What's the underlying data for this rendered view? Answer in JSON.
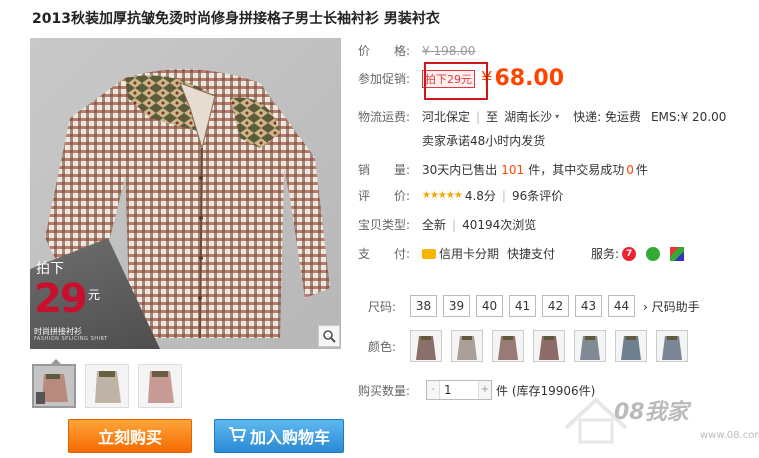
{
  "title": "2013秋装加厚抗皱免烫时尚修身拼接格子男士长袖衬衫 男装衬衣",
  "image_promo": {
    "pai": "拍下",
    "num": "29",
    "yuan": "元",
    "sub": "时尚拼接衬衫",
    "sub_en": "FASHION SPLICING SHIRT"
  },
  "price": {
    "label": "价　　格:",
    "original": "¥ 198.00"
  },
  "promotion": {
    "label": "参加促销:",
    "tag": "拍下29元",
    "currency": "¥",
    "value": "68.00"
  },
  "shipping": {
    "label": "物流运费:",
    "from": "河北保定",
    "to_word": "至",
    "to": "湖南长沙",
    "express": "快递: 免运费",
    "ems": "EMS:¥ 20.00",
    "promise": "卖家承诺48小时内发货"
  },
  "sales": {
    "label": "销　　量:",
    "prefix": "30天内已售出",
    "count": "101",
    "mid": "件，其中交易成功",
    "success": "0",
    "suffix": "件"
  },
  "rating": {
    "label": "评　　价:",
    "stars": "★★★★★",
    "score": "4.8分",
    "reviews": "96条评价"
  },
  "item_type": {
    "label": "宝贝类型:",
    "value": "全新",
    "views": "40194次浏览"
  },
  "payment": {
    "label": "支　　付:",
    "credit": "信用卡分期",
    "quick": "快捷支付",
    "service_label": "服务:"
  },
  "sizes": {
    "label": "尺码:",
    "options": [
      "38",
      "39",
      "40",
      "41",
      "42",
      "43",
      "44"
    ],
    "helper": "尺码助手"
  },
  "colors": {
    "label": "颜色:",
    "swatches": [
      "#8a6f6a",
      "#a9a09a",
      "#9a7a76",
      "#8c6b68",
      "#7f8a95",
      "#6e7f8f",
      "#7c8594"
    ]
  },
  "quantity": {
    "label": "购买数量:",
    "value": "1",
    "minus": "-",
    "plus": "+",
    "stock": "件 (库存19906件)"
  },
  "buttons": {
    "buy": "立刻购买",
    "cart": "加入购物车"
  },
  "watermark": {
    "text": "08我家",
    "url": "www.08.com"
  },
  "colors_theme": {
    "accent": "#ff4400",
    "buy_btn": "#f46b00",
    "cart_btn": "#2b8ad5",
    "highlight_box": "#d01818"
  }
}
